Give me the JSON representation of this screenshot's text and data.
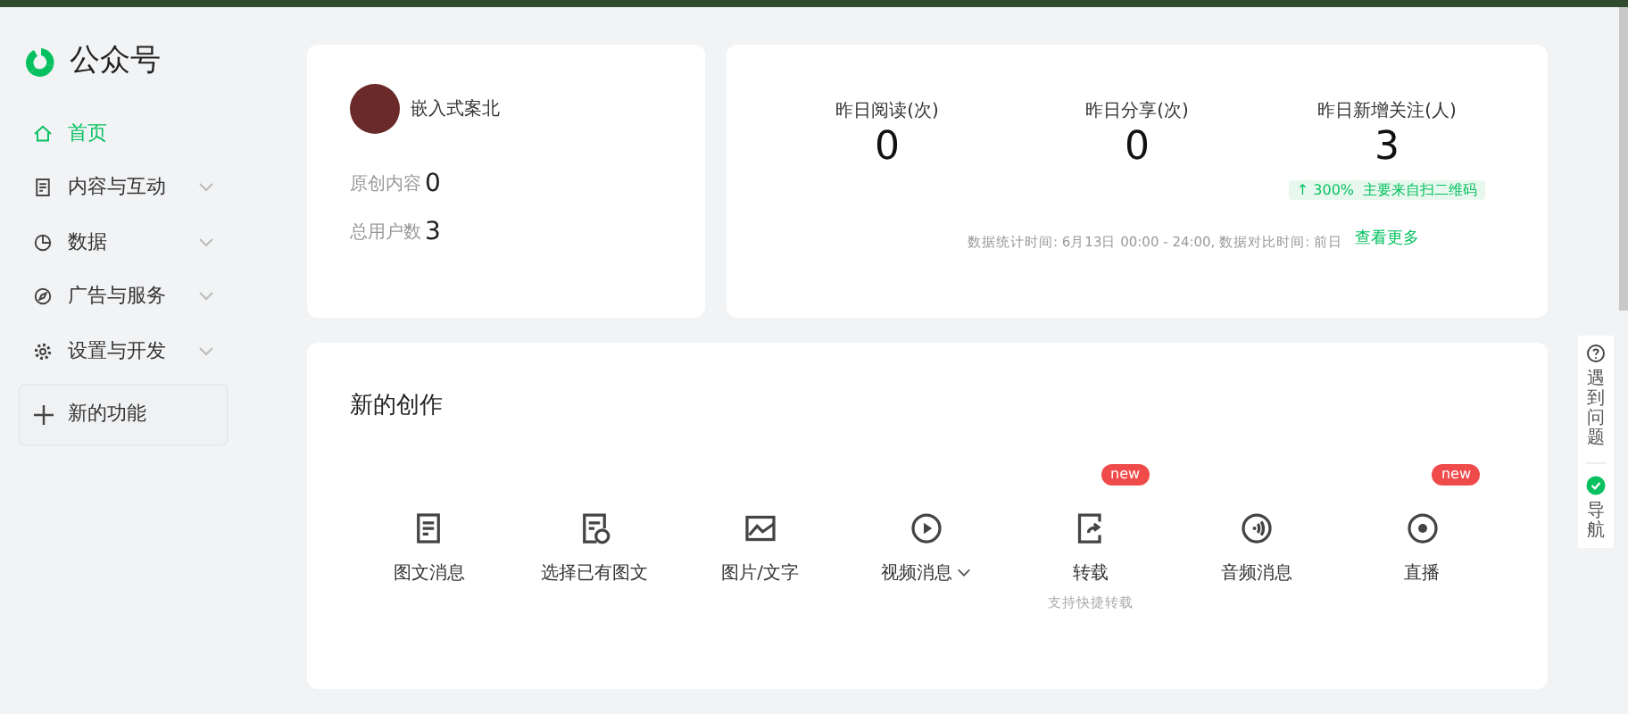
{
  "sidebar": {
    "logo": "公众号",
    "items": [
      {
        "label": "首页",
        "selected": true,
        "expandable": false
      },
      {
        "label": "内容与互动",
        "selected": false,
        "expandable": true
      },
      {
        "label": "数据",
        "selected": false,
        "expandable": true
      },
      {
        "label": "广告与服务",
        "selected": false,
        "expandable": true
      },
      {
        "label": "设置与开发",
        "selected": false,
        "expandable": true
      }
    ],
    "new_feature": "新的功能"
  },
  "account": {
    "name": "嵌入式案北",
    "stats": [
      {
        "label": "原创内容",
        "value": "0"
      },
      {
        "label": "总用户数",
        "value": "3"
      }
    ]
  },
  "yesterday": {
    "metrics": [
      {
        "label": "昨日阅读(次)",
        "value": "0"
      },
      {
        "label": "昨日分享(次)",
        "value": "0"
      },
      {
        "label": "昨日新增关注(人)",
        "value": "3",
        "trend": "↑ 300%",
        "source": "主要来自扫二维码"
      }
    ],
    "note": "数据统计时间: 6月13日 00:00 - 24:00, 数据对比时间: 前日",
    "more": "查看更多"
  },
  "creation": {
    "title": "新的创作",
    "items": [
      {
        "label": "图文消息",
        "dropdown": false
      },
      {
        "label": "选择已有图文",
        "dropdown": false
      },
      {
        "label": "图片/文字",
        "dropdown": false
      },
      {
        "label": "视频消息",
        "dropdown": true
      },
      {
        "label": "转载",
        "badge": "new",
        "sub": "支持快捷转载",
        "dropdown": false
      },
      {
        "label": "音频消息",
        "dropdown": false
      },
      {
        "label": "直播",
        "badge": "new",
        "dropdown": false
      }
    ]
  },
  "help": [
    "遇到问题",
    "导航"
  ]
}
